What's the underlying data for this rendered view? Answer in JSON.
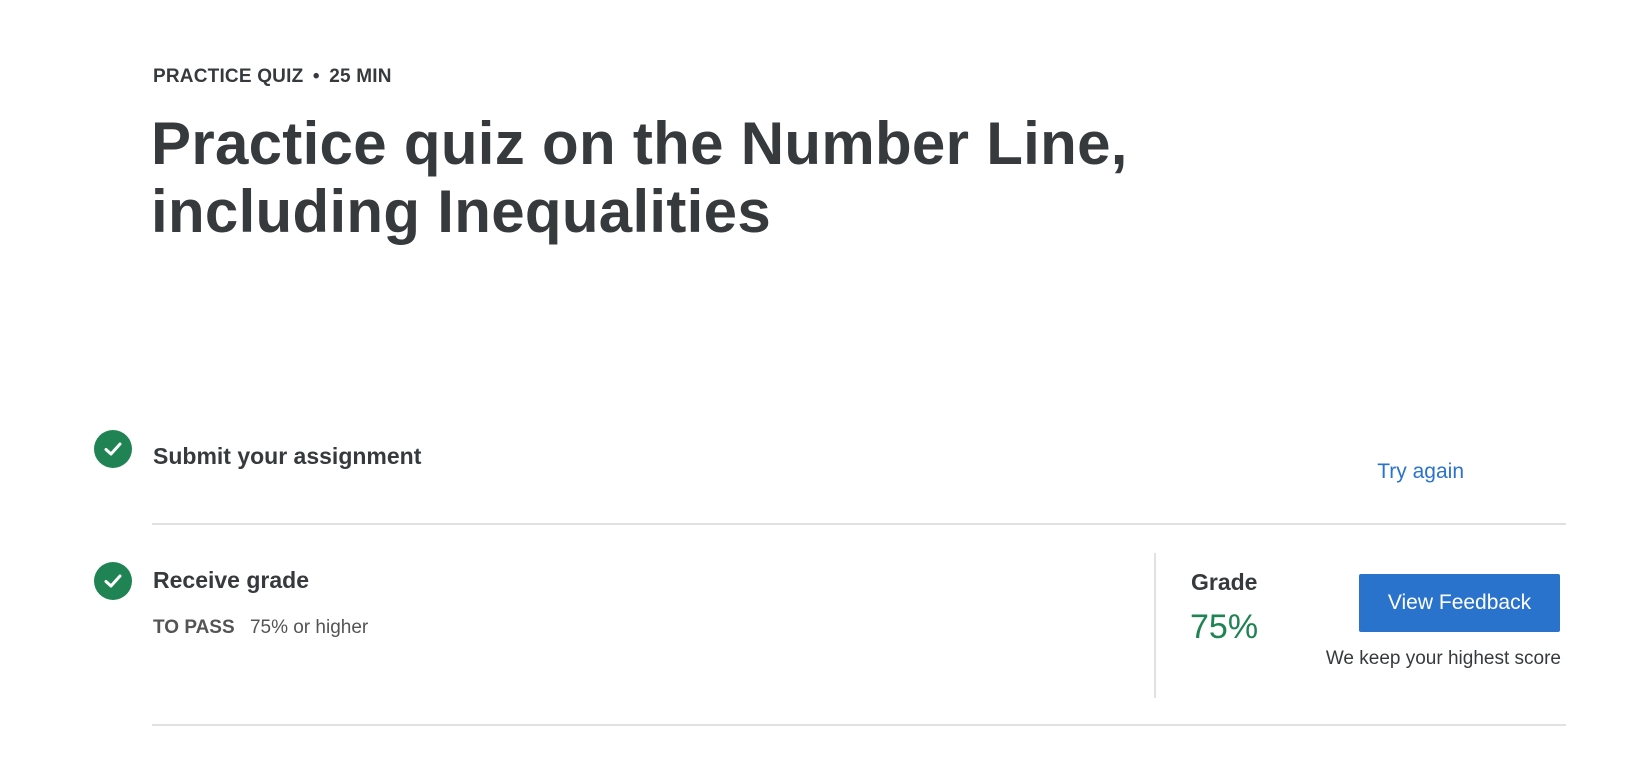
{
  "header": {
    "item_type": "PRACTICE QUIZ",
    "separator": "•",
    "duration": "25 MIN",
    "title": "Practice quiz on the Number Line, including Inequalities"
  },
  "steps": {
    "submit": {
      "title": "Submit your assignment",
      "action_label": "Try again",
      "status_icon": "check-circle-icon"
    },
    "grade": {
      "title": "Receive grade",
      "pass_label": "TO PASS",
      "pass_value": "75% or higher",
      "status_icon": "check-circle-icon",
      "grade_label": "Grade",
      "grade_value": "75%",
      "feedback_button": "View Feedback",
      "note": "We keep your highest score"
    }
  },
  "colors": {
    "success_green": "#1f8354",
    "primary_blue": "#2a73cc",
    "text_dark": "#373a3c",
    "divider": "#e1e1e1"
  }
}
